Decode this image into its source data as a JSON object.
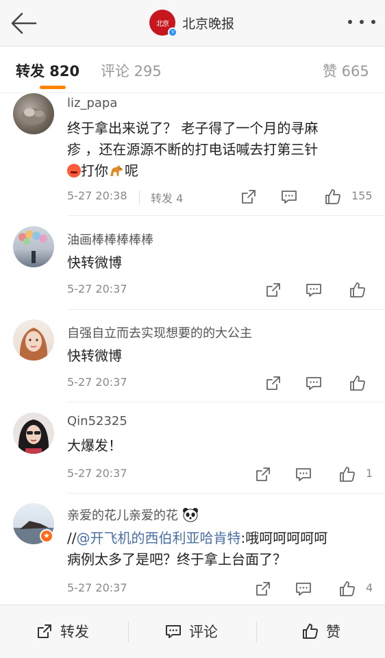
{
  "header": {
    "title": "北京晚报",
    "logo_text": "北京晚报",
    "back_icon": "arrow-left-icon",
    "more_icon": "more-dots-icon"
  },
  "tabs": [
    {
      "label": "转发 820",
      "active": true
    },
    {
      "label": "评论 295",
      "active": false
    },
    {
      "label": "赞 665",
      "active": false
    }
  ],
  "comments": [
    {
      "author": "liz_papa",
      "text_line1": "终于拿出来说了？ 老子得了一个月的寻麻",
      "text_line2": "疹 ，还在源源不断的打电话喊去打第三针",
      "text_part3a": "打你",
      "text_part3b": "呢",
      "time": "5-27 20:38",
      "repost": "转发 4",
      "likes": "155"
    },
    {
      "author": "油画棒棒棒棒棒",
      "text": "快转微博",
      "time": "5-27 20:37",
      "likes": ""
    },
    {
      "author": "自强自立而去实现想要的的大公主",
      "text": "快转微博",
      "time": "5-27 20:37",
      "likes": ""
    },
    {
      "author": "Qin52325",
      "text": "大爆发！",
      "time": "5-27 20:37",
      "likes": "1"
    },
    {
      "author": "亲爱的花儿亲爱的花",
      "text_prefix": "//",
      "mention": "@开飞机的西伯利亚哈肯特",
      "text_rest": ":哦呵呵呵呵呵",
      "text_line2": "病例太多了是吧？终于拿上台面了？",
      "time": "5-27 20:37",
      "likes": "4"
    }
  ],
  "bottom_bar": {
    "repost_label": "转发",
    "comment_label": "评论",
    "like_label": "赞"
  },
  "colors": {
    "accent": "#ff8200",
    "mention": "#4a6fa5",
    "logo": "#c8161e",
    "verified": "#1e90ff"
  }
}
